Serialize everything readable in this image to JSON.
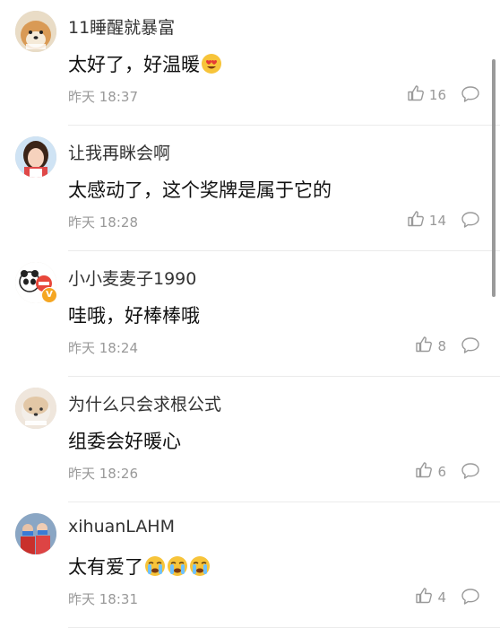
{
  "comments": [
    {
      "username": "11睡醒就暴富",
      "text": "太好了，好温暖",
      "emojis": [
        "heart-eyes-emoji"
      ],
      "time": "昨天 18:37",
      "likes": "16",
      "avatar": "shiba-dog-avatar"
    },
    {
      "username": "让我再眯会啊",
      "text": "太感动了，这个奖牌是属于它的",
      "emojis": [],
      "time": "昨天 18:28",
      "likes": "14",
      "avatar": "girl-avatar"
    },
    {
      "username": "小小麦麦子1990",
      "text": "哇哦，好棒棒哦",
      "emojis": [],
      "time": "昨天 18:24",
      "likes": "8",
      "avatar": "panda-avatar",
      "badge": "V"
    },
    {
      "username": "为什么只会求根公式",
      "text": "组委会好暖心",
      "emojis": [],
      "time": "昨天 18:26",
      "likes": "6",
      "avatar": "dog-avatar"
    },
    {
      "username": "xihuanLAHM",
      "text": "太有爱了",
      "emojis": [
        "crying-emoji",
        "crying-emoji",
        "crying-emoji"
      ],
      "time": "昨天 18:31",
      "likes": "4",
      "avatar": "group-photo-avatar"
    }
  ],
  "colors": {
    "username": "#333333",
    "text": "#111111",
    "meta": "#999999",
    "divider": "#ebebeb",
    "badge": "#f5a623"
  }
}
